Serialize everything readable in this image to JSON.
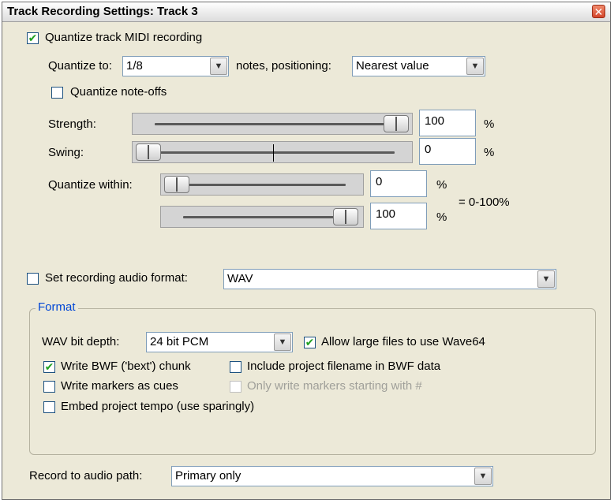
{
  "window": {
    "title": "Track Recording Settings: Track 3",
    "close_glyph": "✕"
  },
  "quantize": {
    "main_label": "Quantize track MIDI recording",
    "main_checked": true,
    "quantize_to_label": "Quantize to:",
    "quantize_to_value": "1/8",
    "notes_positioning_label": "notes, positioning:",
    "positioning_value": "Nearest value",
    "note_offs_label": "Quantize note-offs",
    "note_offs_checked": false,
    "strength_label": "Strength:",
    "strength_value": "100",
    "strength_unit": "%",
    "strength_level": 1.0,
    "swing_label": "Swing:",
    "swing_value": "0",
    "swing_unit": "%",
    "swing_level": 0.0,
    "within_label": "Quantize within:",
    "within_min_value": "0",
    "within_min_unit": "%",
    "within_min_level": 0.0,
    "within_max_value": "100",
    "within_max_unit": "%",
    "within_max_level": 1.0,
    "within_range_text": "= 0-100%"
  },
  "audio_format": {
    "set_format_label": "Set recording audio format:",
    "set_format_checked": false,
    "format_value": "WAV",
    "group_title": "Format",
    "bit_depth_label": "WAV bit depth:",
    "bit_depth_value": "24 bit PCM",
    "wave64_label": "Allow large files to use Wave64",
    "wave64_checked": true,
    "bwf_label": "Write BWF ('bext') chunk",
    "bwf_checked": true,
    "include_filename_label": "Include project filename in BWF data",
    "include_filename_checked": false,
    "markers_cues_label": "Write markers as cues",
    "markers_cues_checked": false,
    "only_markers_label": "Only write markers starting with #",
    "only_markers_checked": false,
    "embed_tempo_label": "Embed project tempo (use sparingly)",
    "embed_tempo_checked": false
  },
  "record_path": {
    "label": "Record to audio path:",
    "value": "Primary only"
  },
  "glyphs": {
    "check": "✔",
    "dropdown": "▼"
  }
}
